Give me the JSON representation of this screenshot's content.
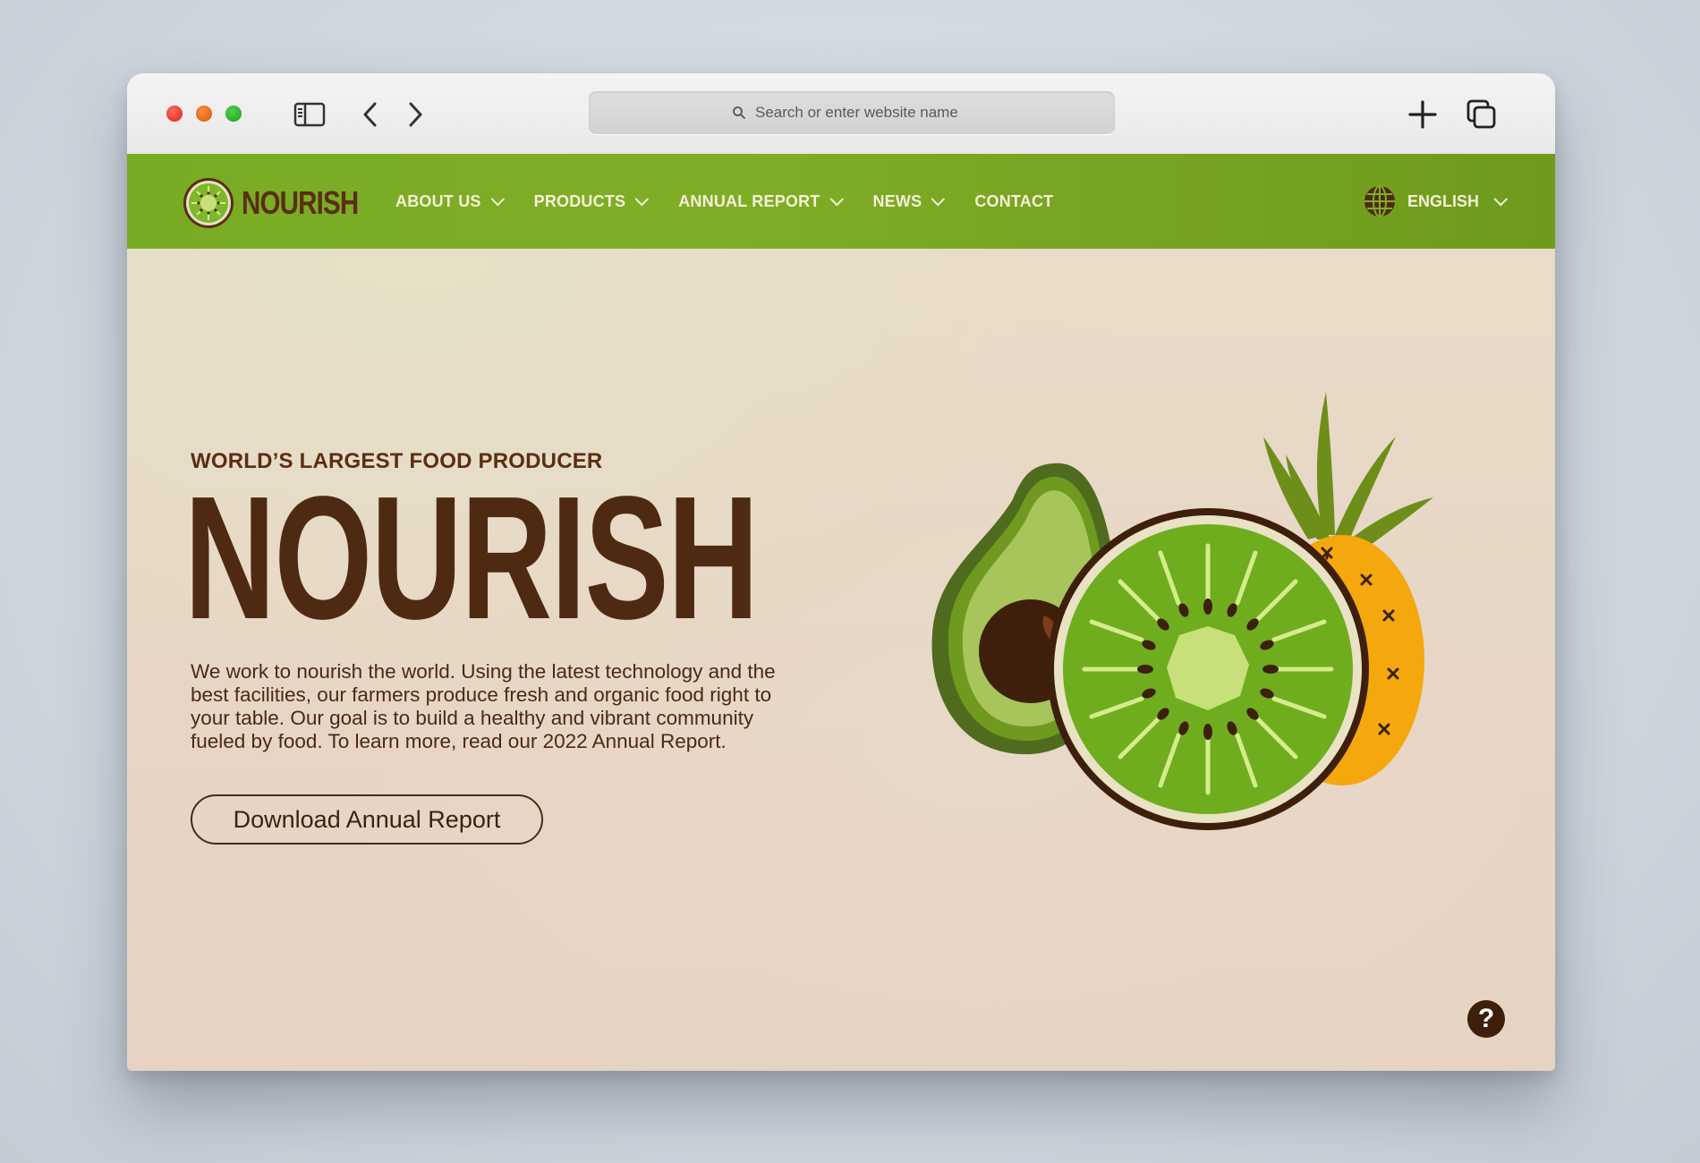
{
  "browser": {
    "address_placeholder": "Search or enter website name"
  },
  "nav": {
    "logo_text": "NOURISH",
    "items": [
      {
        "label": "ABOUT US"
      },
      {
        "label": "PRODUCTS"
      },
      {
        "label": "ANNUAL REPORT"
      },
      {
        "label": "NEWS"
      },
      {
        "label": "CONTACT"
      }
    ],
    "language": "ENGLISH"
  },
  "hero": {
    "kicker": "WORLD’S LARGEST FOOD PRODUCER",
    "title": "NOURISH",
    "description": "We work to nourish the world. Using the latest technology and the best facilities, our farmers produce fresh and organic food right to your table. Our goal is to build a healthy and vibrant community fueled by food. To learn more, read our 2022 Annual Report.",
    "cta_label": "Download Annual Report"
  },
  "help": {
    "label": "?"
  },
  "colors": {
    "nav_green": "#7fae26",
    "brand_brown": "#4f2a12",
    "hero_bg": "#e8dcc8",
    "nav_text": "#f5f0d8"
  },
  "icons": [
    "sidebar-icon",
    "back-icon",
    "forward-icon",
    "search-icon",
    "new-tab-icon",
    "tabs-overview-icon",
    "kiwi-logo-icon",
    "globe-icon",
    "chevron-down-icon",
    "help-icon"
  ]
}
